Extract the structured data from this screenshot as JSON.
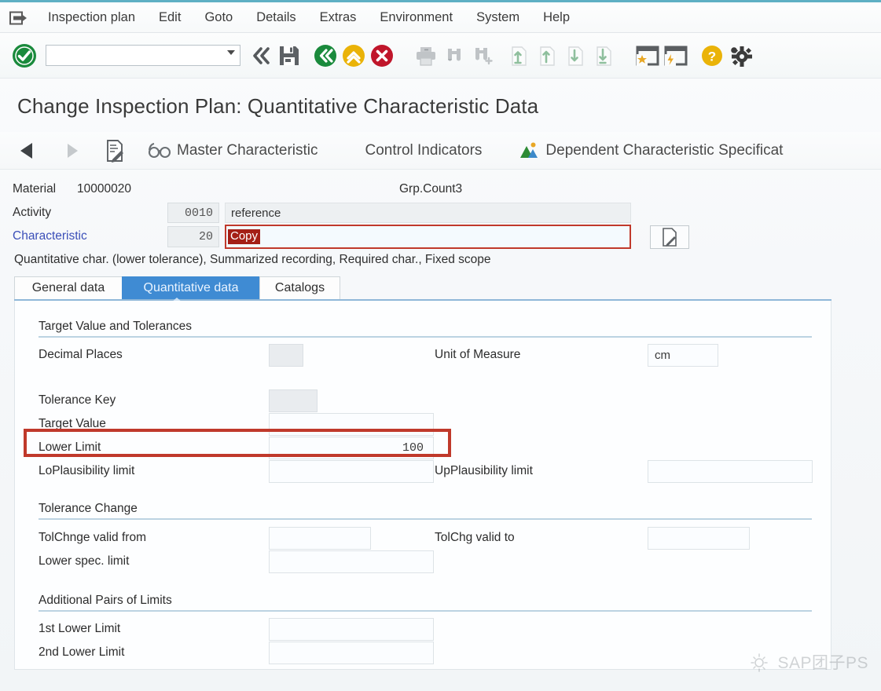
{
  "window": {
    "title": "Change Inspection Plan: Quantitative Characteristic Data"
  },
  "menubar": {
    "system_icon": "system-menu-icon",
    "items": [
      {
        "label": "Inspection plan"
      },
      {
        "label": "Edit"
      },
      {
        "label": "Goto"
      },
      {
        "label": "Details"
      },
      {
        "label": "Extras"
      },
      {
        "label": "Environment"
      },
      {
        "label": "System"
      },
      {
        "label": "Help"
      }
    ]
  },
  "toolbar": {
    "enter_icon": "green-check-enter-icon",
    "command_value": "",
    "command_placeholder": "",
    "dropdown_icon": "chevron-down-icon",
    "collapse_icon": "double-chevron-left-icon",
    "save_icon": "save-floppy-icon",
    "back_icon": "back-green-icon",
    "exit_icon": "exit-yellow-up-icon",
    "cancel_icon": "cancel-red-x-icon",
    "print_icon": "print-icon",
    "find_icon": "find-binoculars-icon",
    "find_next_icon": "find-next-binoculars-plus-icon",
    "first_page_icon": "first-page-icon",
    "previous_page_icon": "previous-page-icon",
    "next_page_icon": "next-page-icon",
    "last_page_icon": "last-page-icon",
    "create_session_icon": "create-session-icon",
    "create_shortcut_icon": "create-shortcut-icon",
    "help_icon": "help-question-icon",
    "customize_icon": "customize-gear-icon"
  },
  "fnbar": {
    "prev_char_icon": "triangle-left-icon",
    "next_char_icon": "triangle-right-icon",
    "detail_icon": "document-edit-icon",
    "master_char_icon": "spectacles-icon",
    "master_char_label": "Master Characteristic",
    "control_indicators_label": "Control Indicators",
    "dependent_spec_icon": "mountain-chart-icon",
    "dependent_spec_label": "Dependent Characteristic Specificat"
  },
  "header": {
    "material_label": "Material",
    "material_value": "10000020",
    "group_counter_label": "Grp.Count3",
    "activity_label": "Activity",
    "activity_value": "0010",
    "activity_text": "reference",
    "characteristic_label": "Characteristic",
    "characteristic_value": "20",
    "characteristic_text": "Copy",
    "detail_icon": "document-detail-icon",
    "description": "Quantitative char. (lower tolerance), Summarized recording, Required char., Fixed scope"
  },
  "tabs": [
    {
      "label": "General data",
      "selected": false
    },
    {
      "label": "Quantitative data",
      "selected": true
    },
    {
      "label": "Catalogs",
      "selected": false
    }
  ],
  "groups": [
    {
      "title": "Target Value and Tolerances",
      "rows": [
        {
          "label": "Decimal Places",
          "value": "",
          "kind": "small-gray",
          "right_label": "Unit of Measure",
          "right_value": "cm",
          "right_kind": "text"
        },
        {
          "label": "Tolerance Key",
          "value": "",
          "kind": "small-gray"
        },
        {
          "label": "Target Value",
          "value": "",
          "kind": "num"
        },
        {
          "label": "Lower Limit",
          "value": "100",
          "kind": "num",
          "highlighted": true
        },
        {
          "label": "LoPlausibility limit",
          "value": "",
          "kind": "num",
          "right_label": "UpPlausibility limit",
          "right_value": "",
          "right_kind": "num"
        }
      ]
    },
    {
      "title": "Tolerance Change",
      "rows": [
        {
          "label": "TolChnge valid from",
          "value": "",
          "kind": "num",
          "right_label": "TolChg valid to",
          "right_value": "",
          "right_kind": "num"
        },
        {
          "label": "Lower spec. limit",
          "value": "",
          "kind": "num"
        }
      ]
    },
    {
      "title": "Additional Pairs of Limits",
      "rows": [
        {
          "label": "1st Lower Limit",
          "value": "",
          "kind": "num"
        },
        {
          "label": "2nd Lower Limit",
          "value": "",
          "kind": "num"
        }
      ]
    }
  ],
  "annotation": {
    "color": "#c0392b",
    "target": "Lower Limit"
  },
  "watermark": {
    "text": "SAP团子PS",
    "icon": "sun-logo-icon"
  }
}
